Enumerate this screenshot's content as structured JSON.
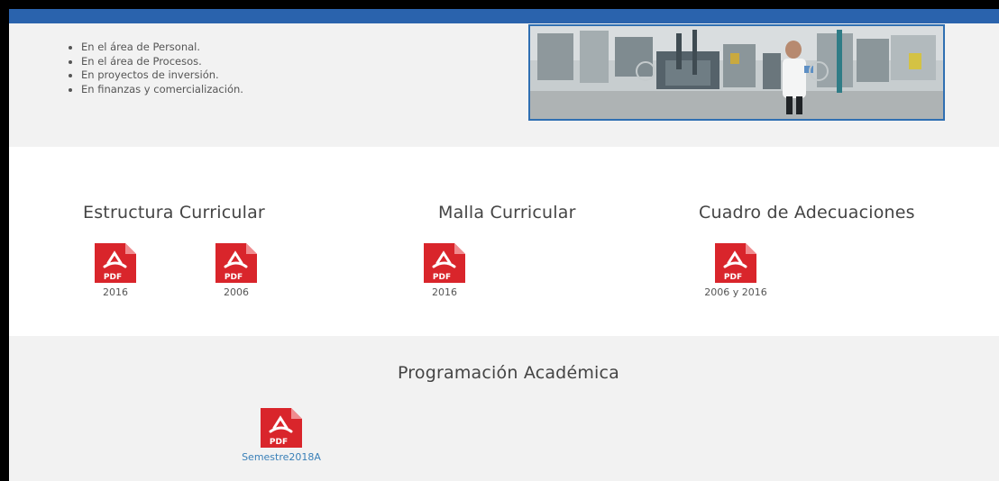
{
  "intro": {
    "bullets": [
      "",
      "En el área de Personal.",
      "En el área de Procesos.",
      "En proyectos de inversión.",
      "En finanzas y comercialización."
    ]
  },
  "sections": {
    "estructura": {
      "title": "Estructura Curricular",
      "files": [
        "2016",
        "2006"
      ]
    },
    "malla": {
      "title": "Malla Curricular",
      "files": [
        "2016"
      ]
    },
    "cuadro": {
      "title": "Cuadro de Adecuaciones",
      "files": [
        "2006 y 2016"
      ]
    },
    "programacion": {
      "title": "Programación Académica",
      "files": [
        "Semestre2018A"
      ]
    }
  },
  "icon": {
    "type_label": "PDF",
    "name": "pdf-file-icon"
  },
  "colors": {
    "accent": "#2a63ad",
    "pdf_red": "#d9252b",
    "link": "#3a80b8"
  }
}
